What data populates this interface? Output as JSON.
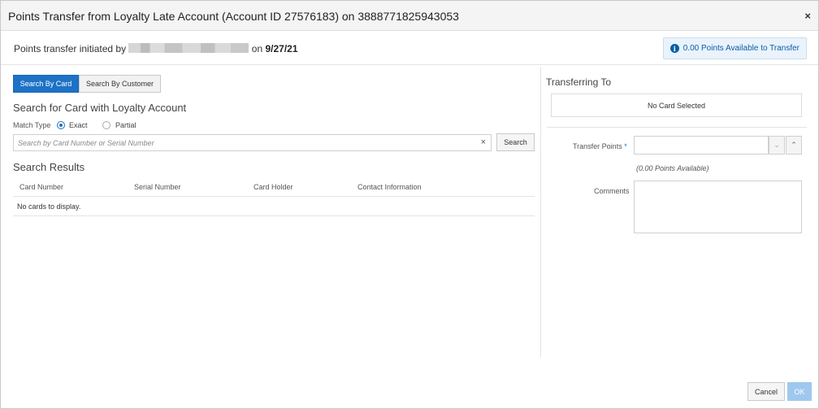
{
  "dialog": {
    "title": "Points Transfer from Loyalty Late Account (Account ID 27576183) on 3888771825943053",
    "close_label": "×"
  },
  "subheader": {
    "initiated_prefix": "Points transfer initiated by",
    "initiated_on": "on",
    "initiated_date": "9/27/21",
    "available_badge": "0.00 Points Available to Transfer",
    "info_glyph": "i"
  },
  "left": {
    "tabs": [
      {
        "label": "Search By Card",
        "active": true
      },
      {
        "label": "Search By Customer",
        "active": false
      }
    ],
    "search_title": "Search for Card with Loyalty Account",
    "match_type_label": "Match Type",
    "match_options": [
      {
        "label": "Exact",
        "checked": true
      },
      {
        "label": "Partial",
        "checked": false
      }
    ],
    "search_placeholder": "Search by Card Number or Serial Number",
    "clear_label": "×",
    "search_button": "Search",
    "results_title": "Search Results",
    "columns": [
      "Card Number",
      "Serial Number",
      "Card Holder",
      "Contact Information"
    ],
    "empty_message": "No cards to display."
  },
  "right": {
    "transferring_to": "Transferring To",
    "no_card_selected": "No Card Selected",
    "transfer_points_label": "Transfer Points",
    "required_mark": "*",
    "points_available_hint": "(0.00 Points Available)",
    "comments_label": "Comments",
    "spin_down": "⌄",
    "spin_up": "⌃"
  },
  "footer": {
    "cancel": "Cancel",
    "ok": "OK"
  }
}
